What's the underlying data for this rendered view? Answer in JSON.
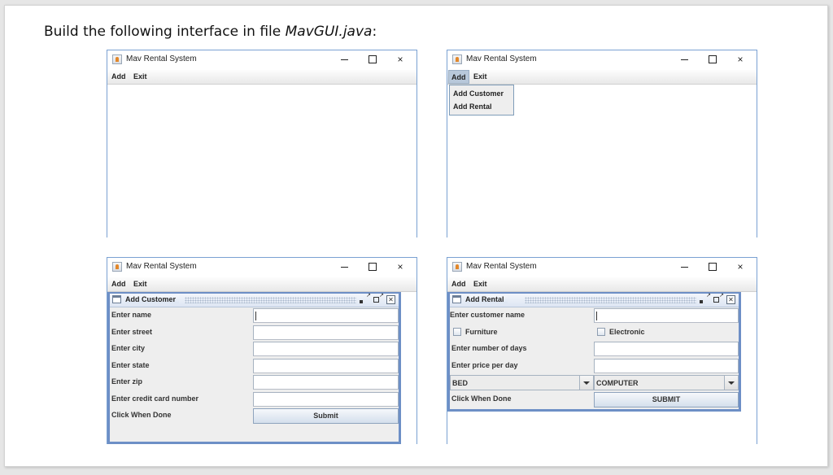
{
  "heading": {
    "prefix": "Build the following interface in file ",
    "filename": "MavGUI.java",
    "suffix": ":"
  },
  "app": {
    "title": "Mav Rental System",
    "menus": [
      "Add",
      "Exit"
    ],
    "window_controls": {
      "minimize": "minimize",
      "maximize": "maximize",
      "close": "×"
    }
  },
  "add_menu_popup": {
    "items": [
      "Add Customer",
      "Add Rental"
    ]
  },
  "add_customer": {
    "title": "Add Customer",
    "fields": [
      {
        "label": "Enter name",
        "value": ""
      },
      {
        "label": "Enter street",
        "value": ""
      },
      {
        "label": "Enter city",
        "value": ""
      },
      {
        "label": "Enter state",
        "value": ""
      },
      {
        "label": "Enter zip",
        "value": ""
      },
      {
        "label": "Enter credit card number",
        "value": ""
      }
    ],
    "done_label": "Click When Done",
    "submit_label": "Submit"
  },
  "add_rental": {
    "title": "Add Rental",
    "customer_name_label": "Enter customer name",
    "checkboxes": [
      {
        "label": "Furniture",
        "checked": false
      },
      {
        "label": "Electronic",
        "checked": false
      }
    ],
    "days_label": "Enter number of days",
    "price_label": "Enter price per day",
    "furniture_combo": {
      "selected": "BED"
    },
    "electronic_combo": {
      "selected": "COMPUTER"
    },
    "done_label": "Click When Done",
    "submit_label": "SUBMIT"
  }
}
